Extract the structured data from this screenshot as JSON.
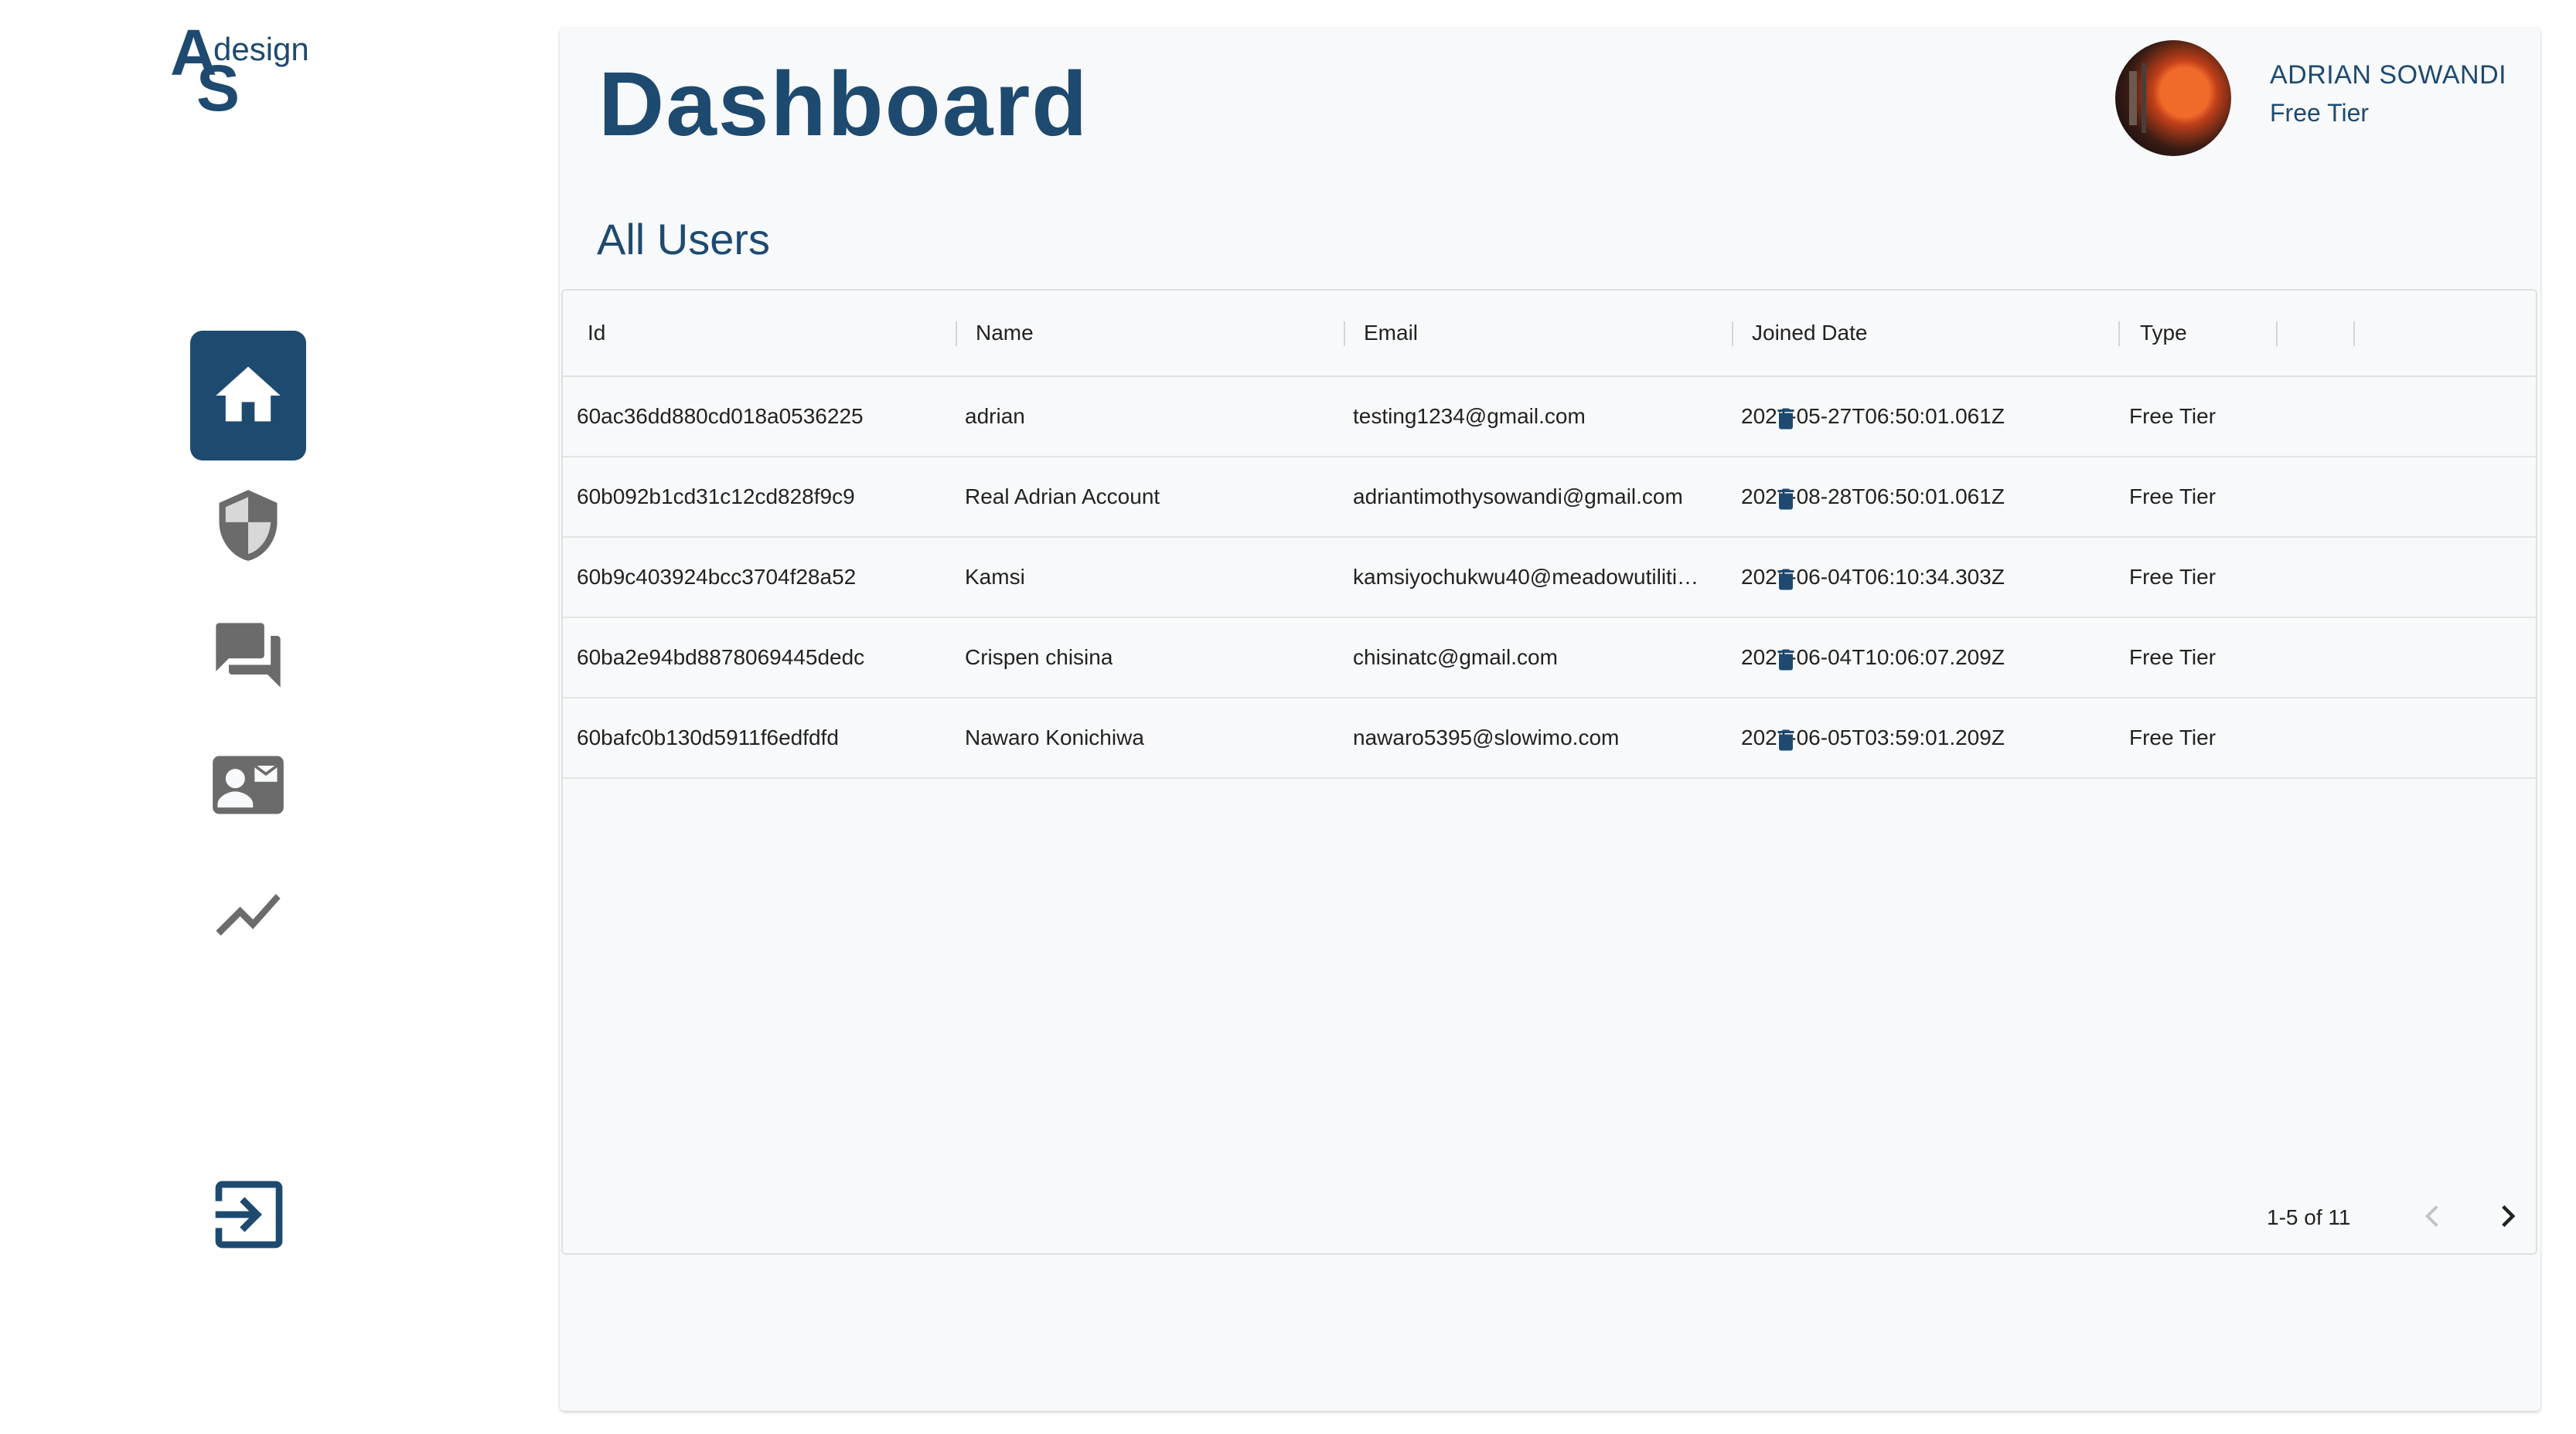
{
  "logo": {
    "letters_a": "A",
    "letters_s": "S",
    "word": "design"
  },
  "sidebar": {
    "items": [
      {
        "icon": "home-icon",
        "active": true
      },
      {
        "icon": "shield-icon",
        "active": false
      },
      {
        "icon": "chat-icon",
        "active": false
      },
      {
        "icon": "contact-card-icon",
        "active": false
      },
      {
        "icon": "trending-icon",
        "active": false
      }
    ],
    "logout_icon": "logout-icon"
  },
  "header": {
    "title": "Dashboard"
  },
  "user": {
    "name": "ADRIAN SOWANDI",
    "tier": "Free Tier"
  },
  "section": {
    "title": "All Users"
  },
  "table": {
    "columns": {
      "id": "Id",
      "name": "Name",
      "email": "Email",
      "joined": "Joined Date",
      "type": "Type"
    },
    "rows": [
      {
        "id": "60ac36dd880cd018a0536225",
        "name": "adrian",
        "email": "testing1234@gmail.com",
        "joined": "2021-05-27T06:50:01.061Z",
        "type": "Free Tier"
      },
      {
        "id": "60b092b1cd31c12cd828f9c9",
        "name": "Real Adrian Account",
        "email": "adriantimothysowandi@gmail.com",
        "joined": "2021-08-28T06:50:01.061Z",
        "type": "Free Tier"
      },
      {
        "id": "60b9c403924bcc3704f28a52",
        "name": "Kamsi",
        "email": "kamsiyochukwu40@meadowutiliti…",
        "joined": "2021-06-04T06:10:34.303Z",
        "type": "Free Tier"
      },
      {
        "id": "60ba2e94bd8878069445dedc",
        "name": "Crispen chisina",
        "email": "chisinatc@gmail.com",
        "joined": "2021-06-04T10:06:07.209Z",
        "type": "Free Tier"
      },
      {
        "id": "60bafc0b130d5911f6edfdfd",
        "name": "Nawaro Konichiwa",
        "email": "nawaro5395@slowimo.com",
        "joined": "2021-06-05T03:59:01.209Z",
        "type": "Free Tier"
      }
    ],
    "pagination": {
      "text": "1-5 of 11"
    }
  },
  "colors": {
    "primary": "#1e4a70",
    "inactive_icon": "#6b6b6b",
    "background": "#f8f9fa"
  }
}
